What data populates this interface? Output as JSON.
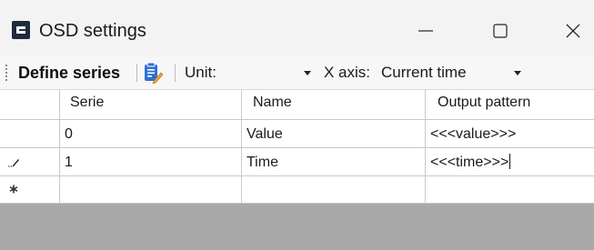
{
  "window": {
    "title": "OSD settings",
    "icon": "app-logo-icon",
    "controls": [
      "minimize-icon",
      "maximize-icon",
      "close-icon"
    ]
  },
  "toolbar": {
    "define_series_label": "Define series",
    "edit_icon": "clipboard-edit-icon",
    "unit_label": "Unit:",
    "unit_value": "",
    "xaxis_label": "X axis:",
    "xaxis_value": "Current time"
  },
  "table": {
    "columns": [
      "Serie",
      "Name",
      "Output pattern"
    ],
    "rows": [
      {
        "marker": "",
        "serie": "0",
        "name": "Value",
        "output_pattern": "<<<value>>>"
      },
      {
        "marker": "pencil-edit-icon",
        "serie": "1",
        "name": "Time",
        "output_pattern": "<<<time>>>"
      },
      {
        "marker": "asterisk-new-row-icon",
        "serie": "",
        "name": "",
        "output_pattern": ""
      }
    ]
  },
  "colors": {
    "titlebar_bg": "#f3f3f3",
    "empty_area_bg": "#a9a9a9",
    "grid_line": "#c8c8c8",
    "icon_blue": "#2f6fd6",
    "icon_orange": "#f0a23a"
  }
}
